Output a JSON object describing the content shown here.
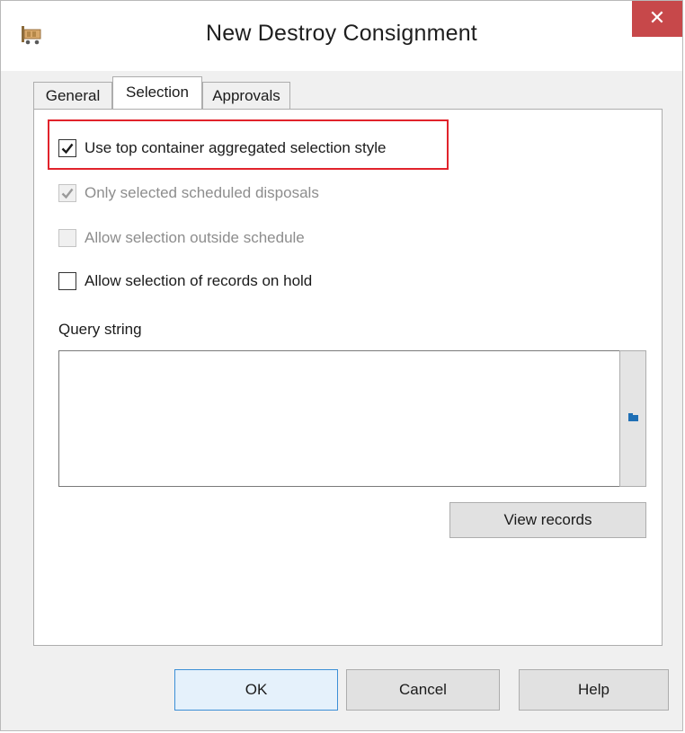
{
  "window": {
    "title": "New Destroy Consignment",
    "close_glyph": "✕",
    "icon": "consignment-cart-icon"
  },
  "tabs": [
    {
      "label": "General",
      "active": false
    },
    {
      "label": "Selection",
      "active": true
    },
    {
      "label": "Approvals",
      "active": false
    }
  ],
  "selection": {
    "options": [
      {
        "label": "Use top container aggregated selection style",
        "checked": true,
        "enabled": true,
        "highlighted": true
      },
      {
        "label": "Only selected scheduled disposals",
        "checked": true,
        "enabled": false
      },
      {
        "label": "Allow selection outside schedule",
        "checked": false,
        "enabled": false
      },
      {
        "label": "Allow selection of records on hold",
        "checked": false,
        "enabled": true
      }
    ],
    "query_label": "Query string",
    "query_value": "",
    "query_browse_icon": "folder-browse-icon",
    "view_records_label": "View records"
  },
  "footer": {
    "ok_label": "OK",
    "cancel_label": "Cancel",
    "help_label": "Help"
  },
  "colors": {
    "highlight": "#e1232b",
    "close_button": "#c7484a",
    "default_button_border": "#3c8fd6"
  }
}
